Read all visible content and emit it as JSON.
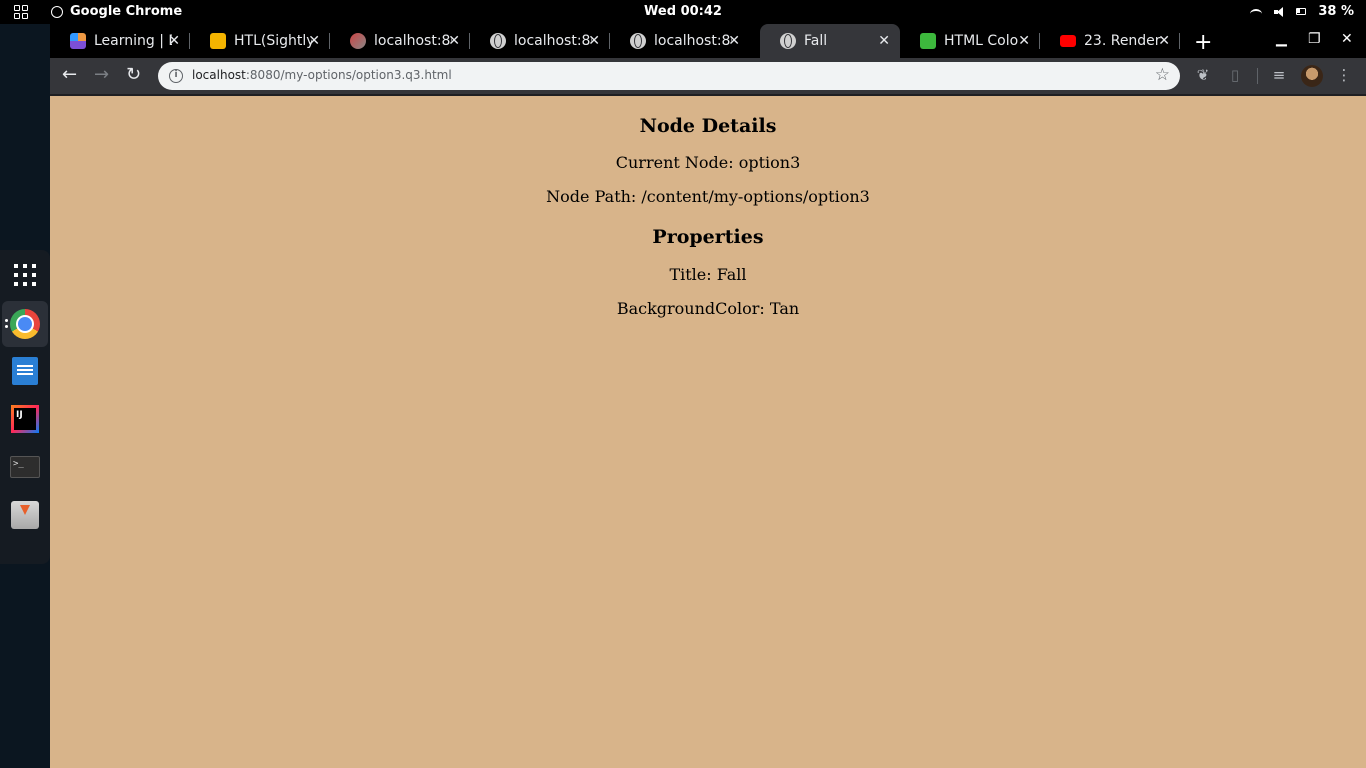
{
  "system": {
    "app_name": "Google Chrome",
    "clock": "Wed 00:42",
    "battery": "38 %"
  },
  "dock": {
    "items": [
      "show-apps-icon",
      "chrome-icon",
      "writer-icon",
      "intellij-icon",
      "terminal-icon",
      "installer-icon"
    ],
    "ij_label": "IJ",
    "term_label": ">_"
  },
  "tabs": [
    {
      "title": "Learning | D",
      "icon": "learning-icon",
      "color": "#7b4fd6"
    },
    {
      "title": "HTL(Sightly",
      "icon": "slides-icon",
      "color": "#f4b400"
    },
    {
      "title": "localhost:80",
      "icon": "crx-icon",
      "color": "#c44"
    },
    {
      "title": "localhost:80",
      "icon": "globe-icon",
      "color": "#d0d0d0"
    },
    {
      "title": "localhost:80",
      "icon": "globe-icon",
      "color": "#d0d0d0"
    },
    {
      "title": "Fall",
      "icon": "globe-icon",
      "color": "#d0d0d0",
      "active": true
    },
    {
      "title": "HTML Colo",
      "icon": "htmlcolor-icon",
      "color": "#3db83d"
    },
    {
      "title": "23. Render",
      "icon": "youtube-icon",
      "color": "#ff0000"
    }
  ],
  "toolbar": {
    "url_host": "localhost",
    "url_rest": ":8080/my-options/option3.q3.html"
  },
  "page": {
    "background": "#D8B48A",
    "heading_details": "Node Details",
    "current_node": "Current Node: option3",
    "node_path": "Node Path: /content/my-options/option3",
    "heading_props": "Properties",
    "title_line": "Title: Fall",
    "bgcolor_line": "BackgroundColor: Tan"
  }
}
